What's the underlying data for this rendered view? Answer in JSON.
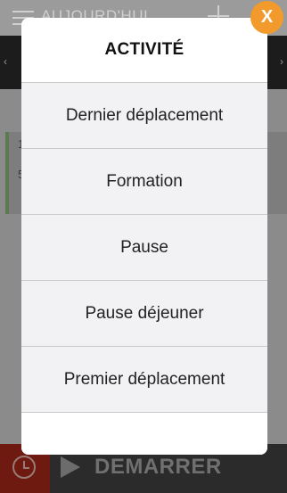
{
  "app": {
    "title": "AUJOURD'HUI",
    "start_label": "DEMARRER"
  },
  "entry": {
    "line1": "1",
    "line2": "5"
  },
  "modal": {
    "title": "ACTIVITÉ",
    "options": [
      {
        "label": "Dernier déplacement"
      },
      {
        "label": "Formation"
      },
      {
        "label": "Pause"
      },
      {
        "label": "Pause déjeuner"
      },
      {
        "label": "Premier déplacement"
      }
    ],
    "close_label": "X"
  },
  "colors": {
    "accent_close": "#f29a2c",
    "modal_bg": "#f2f1f4",
    "start_bar_red": "#6e1a10"
  },
  "icons": [
    "menu-icon",
    "plus-icon",
    "clock-icon",
    "play-icon"
  ]
}
